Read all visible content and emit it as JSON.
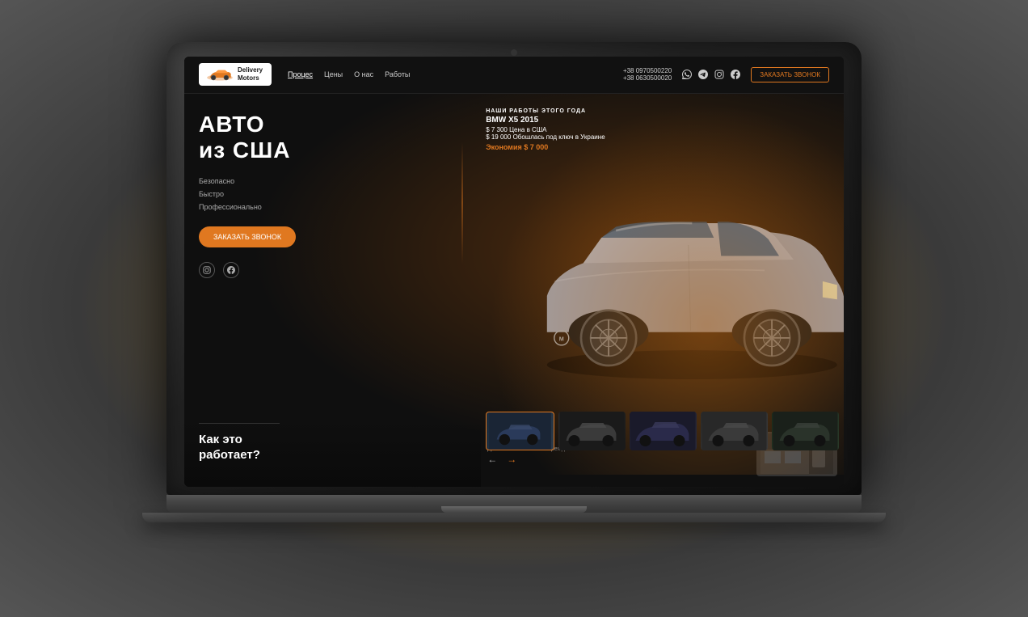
{
  "laptop": {
    "camera_label": "camera"
  },
  "nav": {
    "logo_brand": "Delivery\nMotors",
    "links": [
      {
        "label": "Процес",
        "active": true
      },
      {
        "label": "Цены",
        "active": false
      },
      {
        "label": "О нас",
        "active": false
      },
      {
        "label": "Работы",
        "active": false
      }
    ],
    "phone1": "+38 0970500220",
    "phone2": "+38 0630500020",
    "call_button": "ЗАКАЗАТЬ ЗВОНОК"
  },
  "hero": {
    "title_line1": "АВТО",
    "title_line2": "из США",
    "subtitle_1": "Безопасно",
    "subtitle_2": "Быстро",
    "subtitle_3": "Профессионально",
    "cta_button": "ЗАКАЗАТЬ ЗВОНОК"
  },
  "works": {
    "label_prefix": "НАШИ РАБОТЫ",
    "label_suffix": "ЭТОГО ГОДА",
    "car_model": "BMW X5 2015",
    "price_usa_label": "$ 7 300",
    "price_usa_suffix": "Цена в США",
    "price_ua_label": "$ 19 000",
    "price_ua_suffix": "Обошлась под ключ в Украине",
    "economy": "Экономия $ 7 000"
  },
  "thumbnails": [
    {
      "id": 1,
      "active": true,
      "color": "#1a2a3a"
    },
    {
      "id": 2,
      "active": false,
      "color": "#2a2a2a"
    },
    {
      "id": 3,
      "active": false,
      "color": "#1a1a2a"
    },
    {
      "id": 4,
      "active": false,
      "color": "#2a2a2a"
    },
    {
      "id": 5,
      "active": false,
      "color": "#1a2a1a"
    }
  ],
  "arrows": {
    "left": "←",
    "right": "→"
  },
  "bottom": {
    "how_title_1": "Как это",
    "how_title_2": "работает?",
    "repair_title": "Ремонт",
    "repair_desc": "Даже мельчайшее повреждение авто"
  },
  "socials": {
    "icons": [
      "ig",
      "fb"
    ]
  },
  "colors": {
    "orange": "#e07820",
    "bg": "#0f0f0f",
    "text_primary": "#ffffff",
    "text_secondary": "#aaaaaa"
  }
}
